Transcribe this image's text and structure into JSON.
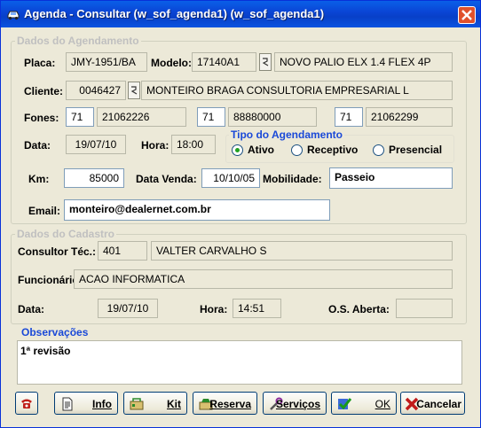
{
  "window": {
    "title": "Agenda - Consultar (w_sof_agenda1) (w_sof_agenda1)"
  },
  "groups": {
    "agendamento": "Dados do Agendamento",
    "cadastro": "Dados do Cadastro",
    "tipo": "Tipo do Agendamento",
    "observacoes": "Observações"
  },
  "labels": {
    "placa": "Placa:",
    "modelo": "Modelo:",
    "cliente": "Cliente:",
    "fones": "Fones:",
    "data": "Data:",
    "hora": "Hora:",
    "km": "Km:",
    "data_venda": "Data Venda:",
    "mobilidade": "Mobilidade:",
    "email": "Email:",
    "consultor": "Consultor Téc.:",
    "funcionario": "Funcionário:",
    "data2": "Data:",
    "hora2": "Hora:",
    "os_aberta": "O.S. Aberta:"
  },
  "fields": {
    "placa": "JMY-1951/BA",
    "modelo_cod": "17140A1",
    "modelo_desc": "NOVO PALIO ELX 1.4 FLEX 4P",
    "cliente_cod": "0046427",
    "cliente_nome": "MONTEIRO BRAGA CONSULTORIA EMPRESARIAL L",
    "ddd1": "71",
    "fone1": "21062226",
    "ddd2": "71",
    "fone2": "88880000",
    "ddd3": "71",
    "fone3": "21062299",
    "data": "19/07/10",
    "hora": "18:00",
    "km": "85000",
    "data_venda": "10/10/05",
    "mobilidade": "Passeio",
    "email": "monteiro@dealernet.com.br",
    "consultor_cod": "401",
    "consultor_nome": "VALTER CARVALHO S",
    "funcionario": "ACAO INFORMATICA",
    "data_cad": "19/07/10",
    "hora_cad": "14:51",
    "os_aberta": "",
    "observacoes": "1ª revisão"
  },
  "tipo": {
    "options": [
      "Ativo",
      "Receptivo",
      "Presencial"
    ],
    "selected": "Ativo"
  },
  "buttons": {
    "info": "Info",
    "kit": "Kit",
    "reserva": "Reserva",
    "servicos": "Serviços",
    "ok": "OK",
    "cancelar": "Cancelar"
  },
  "colors": {
    "title_bar": "#0a46d6",
    "group_title_active": "#1a49d8",
    "radio_selected": "#21a121"
  }
}
